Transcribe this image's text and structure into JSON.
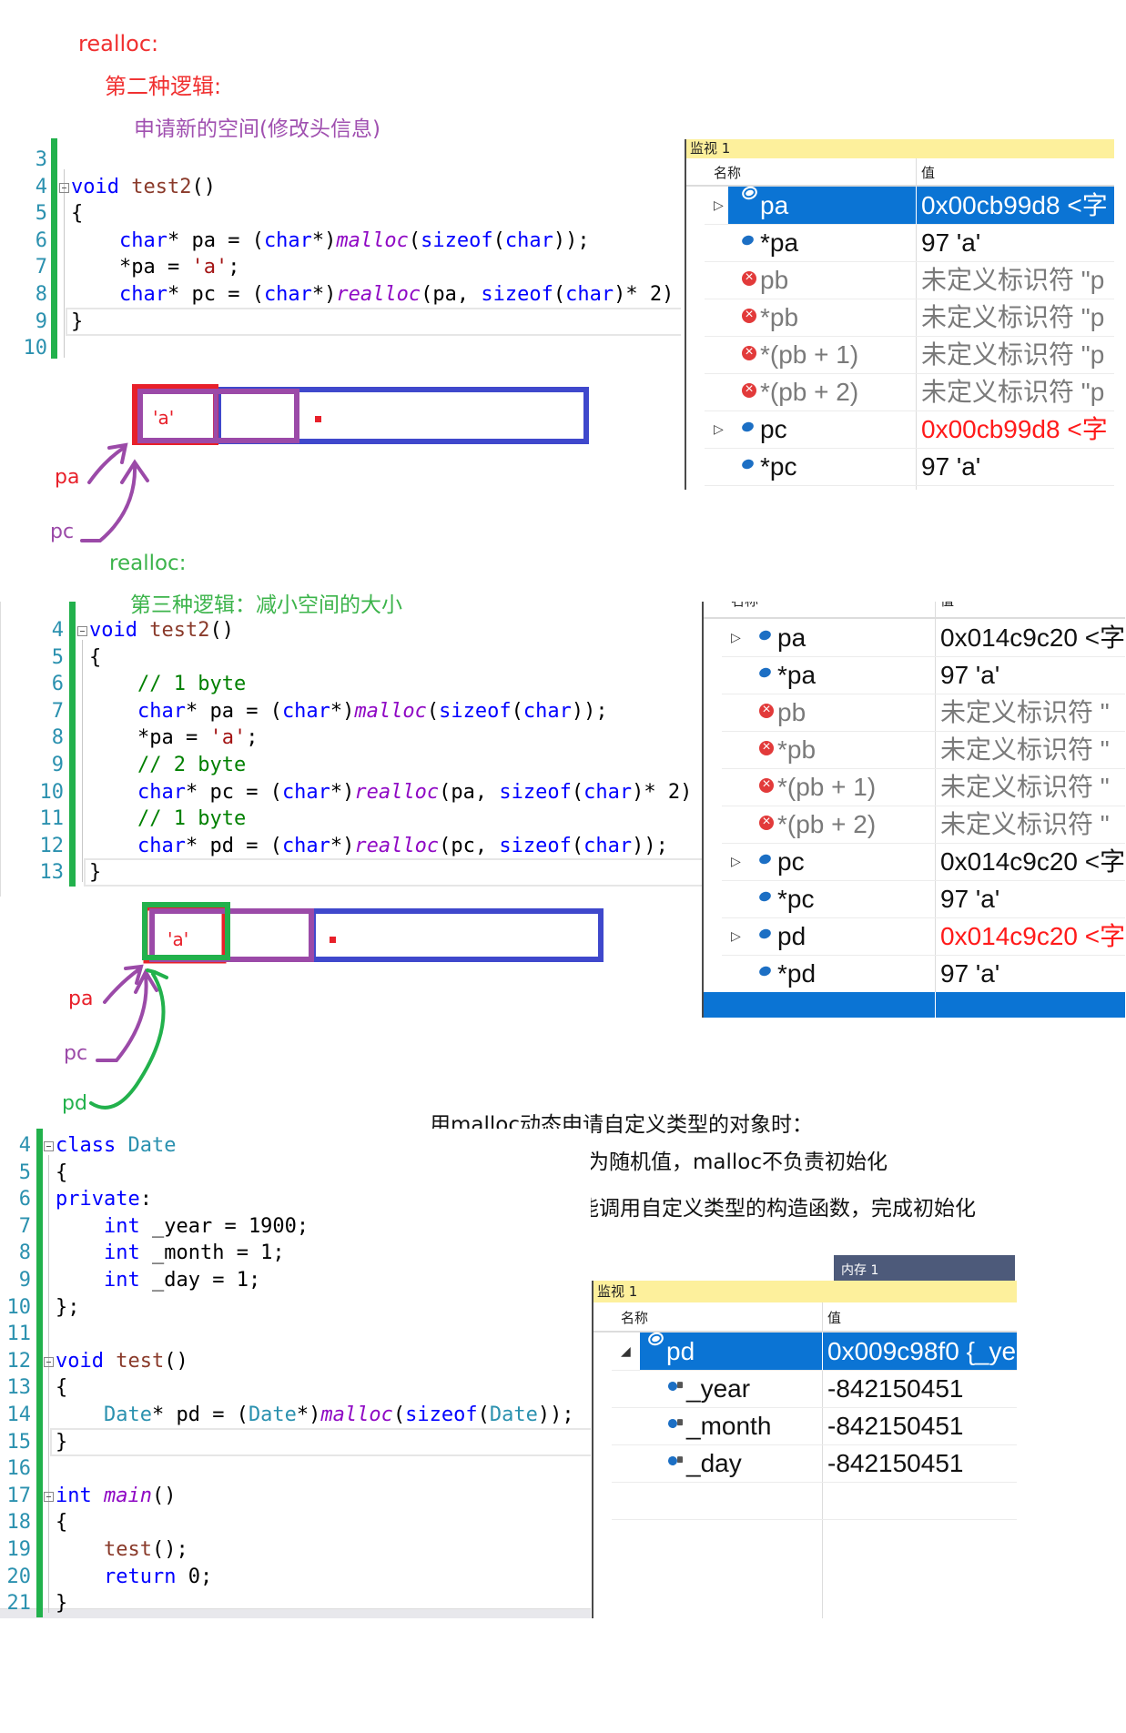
{
  "notes": {
    "s1_title": "realloc:",
    "s1_sub": "第二种逻辑:",
    "s1_desc": "申请新的空间(修改头信息)",
    "s2_title": "realloc:",
    "s2_sub": "第三种逻辑：减小空间的大小",
    "s3_line1": "用malloc动态申请自定义类型的对象时：",
    "s3_line2": "对象的内容为随机值，malloc不负责初始化",
    "s3_line3": "malloc不能调用自定义类型的构造函数，完成初始化"
  },
  "colors": {
    "red": "#e8202a",
    "purple": "#9b4aa8",
    "blue": "#3f48cc",
    "green": "#22b14c",
    "selection": "#0b74d4",
    "watch_title": "#fdf09c"
  },
  "diagram1": {
    "cell_value": "'a'",
    "labels": {
      "pa": "pa",
      "pc": "pc"
    }
  },
  "diagram2": {
    "cell_value": "'a'",
    "labels": {
      "pa": "pa",
      "pc": "pc",
      "pd": "pd"
    }
  },
  "editors": [
    {
      "lines": [
        {
          "num": "3",
          "tokens": []
        },
        {
          "num": "4",
          "fold": true,
          "tokens": [
            [
              "void",
              "kw"
            ],
            [
              " ",
              "pl"
            ],
            [
              "test2",
              "fn"
            ],
            [
              "()",
              "pl"
            ]
          ]
        },
        {
          "num": "5",
          "tokens": [
            [
              "{",
              "pl"
            ]
          ]
        },
        {
          "num": "6",
          "tokens": [
            [
              "    ",
              "pl"
            ],
            [
              "char",
              "kw"
            ],
            [
              "* pa = (",
              "pl"
            ],
            [
              "char",
              "kw"
            ],
            [
              "*)",
              "pl"
            ],
            [
              "malloc",
              "mf"
            ],
            [
              "(",
              "pl"
            ],
            [
              "sizeof",
              "kw"
            ],
            [
              "(",
              "pl"
            ],
            [
              "char",
              "kw"
            ],
            [
              "));",
              "pl"
            ]
          ]
        },
        {
          "num": "7",
          "tokens": [
            [
              "    *pa = ",
              "pl"
            ],
            [
              "'a'",
              "str"
            ],
            [
              ";",
              "pl"
            ]
          ]
        },
        {
          "num": "8",
          "tokens": [
            [
              "    ",
              "pl"
            ],
            [
              "char",
              "kw"
            ],
            [
              "* pc = (",
              "pl"
            ],
            [
              "char",
              "kw"
            ],
            [
              "*)",
              "pl"
            ],
            [
              "realloc",
              "mf"
            ],
            [
              "(pa, ",
              "pl"
            ],
            [
              "sizeof",
              "kw"
            ],
            [
              "(",
              "pl"
            ],
            [
              "char",
              "kw"
            ],
            [
              ")* 2)",
              "pl"
            ]
          ]
        },
        {
          "num": "9",
          "current": true,
          "tokens": [
            [
              "}",
              "pl"
            ]
          ]
        },
        {
          "num": "10",
          "tokens": []
        }
      ]
    },
    {
      "lines": [
        {
          "num": "4",
          "fold": true,
          "tokens": [
            [
              "void",
              "kw"
            ],
            [
              " ",
              "pl"
            ],
            [
              "test2",
              "fn"
            ],
            [
              "()",
              "pl"
            ]
          ]
        },
        {
          "num": "5",
          "tokens": [
            [
              "{",
              "pl"
            ]
          ]
        },
        {
          "num": "6",
          "tokens": [
            [
              "    ",
              "pl"
            ],
            [
              "// 1 byte",
              "cm"
            ]
          ]
        },
        {
          "num": "7",
          "tokens": [
            [
              "    ",
              "pl"
            ],
            [
              "char",
              "kw"
            ],
            [
              "* pa = (",
              "pl"
            ],
            [
              "char",
              "kw"
            ],
            [
              "*)",
              "pl"
            ],
            [
              "malloc",
              "mf"
            ],
            [
              "(",
              "pl"
            ],
            [
              "sizeof",
              "kw"
            ],
            [
              "(",
              "pl"
            ],
            [
              "char",
              "kw"
            ],
            [
              "));",
              "pl"
            ]
          ]
        },
        {
          "num": "8",
          "tokens": [
            [
              "    *pa = ",
              "pl"
            ],
            [
              "'a'",
              "str"
            ],
            [
              ";",
              "pl"
            ]
          ]
        },
        {
          "num": "9",
          "tokens": [
            [
              "    ",
              "pl"
            ],
            [
              "// 2 byte",
              "cm"
            ]
          ]
        },
        {
          "num": "10",
          "tokens": [
            [
              "    ",
              "pl"
            ],
            [
              "char",
              "kw"
            ],
            [
              "* pc = (",
              "pl"
            ],
            [
              "char",
              "kw"
            ],
            [
              "*)",
              "pl"
            ],
            [
              "realloc",
              "mf"
            ],
            [
              "(pa, ",
              "pl"
            ],
            [
              "sizeof",
              "kw"
            ],
            [
              "(",
              "pl"
            ],
            [
              "char",
              "kw"
            ],
            [
              ")* 2)",
              "pl"
            ]
          ]
        },
        {
          "num": "11",
          "tokens": [
            [
              "    ",
              "pl"
            ],
            [
              "// 1 byte",
              "cm"
            ]
          ]
        },
        {
          "num": "12",
          "tokens": [
            [
              "    ",
              "pl"
            ],
            [
              "char",
              "kw"
            ],
            [
              "* pd = (",
              "pl"
            ],
            [
              "char",
              "kw"
            ],
            [
              "*)",
              "pl"
            ],
            [
              "realloc",
              "mf"
            ],
            [
              "(pc, ",
              "pl"
            ],
            [
              "sizeof",
              "kw"
            ],
            [
              "(",
              "pl"
            ],
            [
              "char",
              "kw"
            ],
            [
              "));",
              "pl"
            ]
          ]
        },
        {
          "num": "13",
          "current": true,
          "tokens": [
            [
              "}",
              "pl"
            ]
          ]
        }
      ]
    },
    {
      "lines": [
        {
          "num": "4",
          "fold": true,
          "tokens": [
            [
              "class",
              "kw"
            ],
            [
              " ",
              "pl"
            ],
            [
              "Date",
              "ty"
            ]
          ]
        },
        {
          "num": "5",
          "tokens": [
            [
              "{",
              "pl"
            ]
          ]
        },
        {
          "num": "6",
          "tokens": [
            [
              "private",
              "kw"
            ],
            [
              ":",
              "pl"
            ]
          ]
        },
        {
          "num": "7",
          "tokens": [
            [
              "    ",
              "pl"
            ],
            [
              "int",
              "kw"
            ],
            [
              " _year = 1900;",
              "pl"
            ]
          ]
        },
        {
          "num": "8",
          "tokens": [
            [
              "    ",
              "pl"
            ],
            [
              "int",
              "kw"
            ],
            [
              " _month = 1;",
              "pl"
            ]
          ]
        },
        {
          "num": "9",
          "tokens": [
            [
              "    ",
              "pl"
            ],
            [
              "int",
              "kw"
            ],
            [
              " _day = 1;",
              "pl"
            ]
          ]
        },
        {
          "num": "10",
          "tokens": [
            [
              "};",
              "pl"
            ]
          ]
        },
        {
          "num": "11",
          "tokens": []
        },
        {
          "num": "12",
          "fold": true,
          "tokens": [
            [
              "void",
              "kw"
            ],
            [
              " ",
              "pl"
            ],
            [
              "test",
              "fn"
            ],
            [
              "()",
              "pl"
            ]
          ]
        },
        {
          "num": "13",
          "tokens": [
            [
              "{",
              "pl"
            ]
          ]
        },
        {
          "num": "14",
          "tokens": [
            [
              "    ",
              "pl"
            ],
            [
              "Date",
              "ty"
            ],
            [
              "* pd = (",
              "pl"
            ],
            [
              "Date",
              "ty"
            ],
            [
              "*)",
              "pl"
            ],
            [
              "malloc",
              "mf"
            ],
            [
              "(",
              "pl"
            ],
            [
              "sizeof",
              "kw"
            ],
            [
              "(",
              "pl"
            ],
            [
              "Date",
              "ty"
            ],
            [
              "));",
              "pl"
            ]
          ]
        },
        {
          "num": "15",
          "current": true,
          "tokens": [
            [
              "}",
              "pl"
            ]
          ]
        },
        {
          "num": "16",
          "tokens": []
        },
        {
          "num": "17",
          "fold": true,
          "tokens": [
            [
              "int",
              "kw"
            ],
            [
              " ",
              "pl"
            ],
            [
              "main",
              "mf"
            ],
            [
              "()",
              "pl"
            ]
          ]
        },
        {
          "num": "18",
          "tokens": [
            [
              "{",
              "pl"
            ]
          ]
        },
        {
          "num": "19",
          "tokens": [
            [
              "    ",
              "pl"
            ],
            [
              "test",
              "fn"
            ],
            [
              "();",
              "pl"
            ]
          ]
        },
        {
          "num": "20",
          "tokens": [
            [
              "    ",
              "pl"
            ],
            [
              "return",
              "kw"
            ],
            [
              " 0;",
              "pl"
            ]
          ]
        },
        {
          "num": "21",
          "tokens": [
            [
              "}",
              "pl"
            ]
          ]
        }
      ]
    }
  ],
  "watches": [
    {
      "title": "监视 1",
      "col_name": "名称",
      "col_value": "值",
      "rows": [
        {
          "expand": "▷",
          "icon": "variable",
          "name": "pa",
          "value": "0x00cb99d8  <字",
          "selected": true
        },
        {
          "icon": "variable",
          "name": "*pa",
          "value": "97 'a'"
        },
        {
          "icon": "error",
          "name": "pb",
          "value": "未定义标识符 \"p",
          "error": true
        },
        {
          "icon": "error",
          "name": "*pb",
          "value": "未定义标识符 \"p",
          "error": true
        },
        {
          "icon": "error",
          "name": "*(pb + 1)",
          "value": "未定义标识符 \"p",
          "error": true
        },
        {
          "icon": "error",
          "name": "*(pb + 2)",
          "value": "未定义标识符 \"p",
          "error": true
        },
        {
          "expand": "▷",
          "icon": "variable",
          "name": "pc",
          "value": "0x00cb99d8  <字",
          "changed": true
        },
        {
          "icon": "variable",
          "name": "*pc",
          "value": "97 'a'"
        }
      ]
    },
    {
      "col_name": "名称",
      "col_value": "值",
      "rows": [
        {
          "expand": "▷",
          "icon": "variable",
          "name": "pa",
          "value": "0x014c9c20  <字"
        },
        {
          "icon": "variable",
          "name": "*pa",
          "value": "97 'a'"
        },
        {
          "icon": "error",
          "name": "pb",
          "value": "未定义标识符 \"",
          "error": true
        },
        {
          "icon": "error",
          "name": "*pb",
          "value": "未定义标识符 \"",
          "error": true
        },
        {
          "icon": "error",
          "name": "*(pb + 1)",
          "value": "未定义标识符 \"",
          "error": true
        },
        {
          "icon": "error",
          "name": "*(pb + 2)",
          "value": "未定义标识符 \"",
          "error": true
        },
        {
          "expand": "▷",
          "icon": "variable",
          "name": "pc",
          "value": "0x014c9c20  <字"
        },
        {
          "icon": "variable",
          "name": "*pc",
          "value": "97 'a'"
        },
        {
          "expand": "▷",
          "icon": "variable",
          "name": "pd",
          "value": "0x014c9c20  <字",
          "changed": true
        },
        {
          "icon": "variable",
          "name": "*pd",
          "value": "97 'a'"
        },
        {
          "name": "",
          "value": "",
          "selected_full": true
        }
      ]
    },
    {
      "title": "监视 1",
      "col_name": "名称",
      "col_value": "值",
      "memory_tab": "内存 1",
      "rows": [
        {
          "expand": "◢",
          "icon": "variable",
          "name": "pd",
          "value": "0x009c98f0 {_ye",
          "selected": true
        },
        {
          "icon": "field",
          "child": true,
          "name": "_year",
          "value": "-842150451"
        },
        {
          "icon": "field",
          "child": true,
          "name": "_month",
          "value": "-842150451"
        },
        {
          "icon": "field",
          "child": true,
          "name": "_day",
          "value": "-842150451"
        },
        {
          "name": "",
          "value": ""
        }
      ]
    }
  ]
}
